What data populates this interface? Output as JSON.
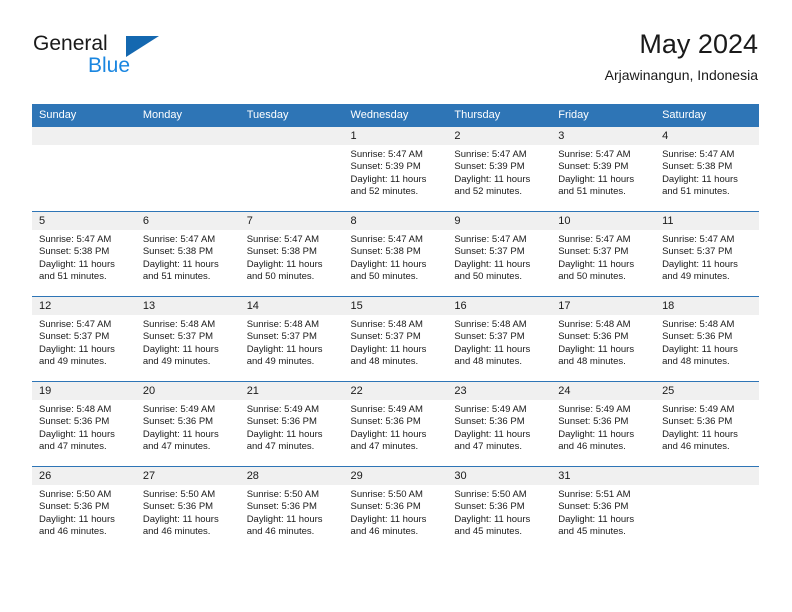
{
  "brand": {
    "name_part1": "General",
    "name_part2": "Blue",
    "triangle_color": "#1468b0",
    "blue_text_color": "#1a86e0"
  },
  "header": {
    "title": "May 2024",
    "subtitle": "Arjawinangun, Indonesia",
    "header_bg": "#2e75b6",
    "daynum_bg": "#f0f0f0"
  },
  "weekday_headers": [
    "Sunday",
    "Monday",
    "Tuesday",
    "Wednesday",
    "Thursday",
    "Friday",
    "Saturday"
  ],
  "weeks": [
    [
      {
        "day": "",
        "blank": true
      },
      {
        "day": "",
        "blank": true
      },
      {
        "day": "",
        "blank": true
      },
      {
        "day": "1",
        "sunrise": "Sunrise: 5:47 AM",
        "sunset": "Sunset: 5:39 PM",
        "daylight": "Daylight: 11 hours and 52 minutes."
      },
      {
        "day": "2",
        "sunrise": "Sunrise: 5:47 AM",
        "sunset": "Sunset: 5:39 PM",
        "daylight": "Daylight: 11 hours and 52 minutes."
      },
      {
        "day": "3",
        "sunrise": "Sunrise: 5:47 AM",
        "sunset": "Sunset: 5:39 PM",
        "daylight": "Daylight: 11 hours and 51 minutes."
      },
      {
        "day": "4",
        "sunrise": "Sunrise: 5:47 AM",
        "sunset": "Sunset: 5:38 PM",
        "daylight": "Daylight: 11 hours and 51 minutes."
      }
    ],
    [
      {
        "day": "5",
        "sunrise": "Sunrise: 5:47 AM",
        "sunset": "Sunset: 5:38 PM",
        "daylight": "Daylight: 11 hours and 51 minutes."
      },
      {
        "day": "6",
        "sunrise": "Sunrise: 5:47 AM",
        "sunset": "Sunset: 5:38 PM",
        "daylight": "Daylight: 11 hours and 51 minutes."
      },
      {
        "day": "7",
        "sunrise": "Sunrise: 5:47 AM",
        "sunset": "Sunset: 5:38 PM",
        "daylight": "Daylight: 11 hours and 50 minutes."
      },
      {
        "day": "8",
        "sunrise": "Sunrise: 5:47 AM",
        "sunset": "Sunset: 5:38 PM",
        "daylight": "Daylight: 11 hours and 50 minutes."
      },
      {
        "day": "9",
        "sunrise": "Sunrise: 5:47 AM",
        "sunset": "Sunset: 5:37 PM",
        "daylight": "Daylight: 11 hours and 50 minutes."
      },
      {
        "day": "10",
        "sunrise": "Sunrise: 5:47 AM",
        "sunset": "Sunset: 5:37 PM",
        "daylight": "Daylight: 11 hours and 50 minutes."
      },
      {
        "day": "11",
        "sunrise": "Sunrise: 5:47 AM",
        "sunset": "Sunset: 5:37 PM",
        "daylight": "Daylight: 11 hours and 49 minutes."
      }
    ],
    [
      {
        "day": "12",
        "sunrise": "Sunrise: 5:47 AM",
        "sunset": "Sunset: 5:37 PM",
        "daylight": "Daylight: 11 hours and 49 minutes."
      },
      {
        "day": "13",
        "sunrise": "Sunrise: 5:48 AM",
        "sunset": "Sunset: 5:37 PM",
        "daylight": "Daylight: 11 hours and 49 minutes."
      },
      {
        "day": "14",
        "sunrise": "Sunrise: 5:48 AM",
        "sunset": "Sunset: 5:37 PM",
        "daylight": "Daylight: 11 hours and 49 minutes."
      },
      {
        "day": "15",
        "sunrise": "Sunrise: 5:48 AM",
        "sunset": "Sunset: 5:37 PM",
        "daylight": "Daylight: 11 hours and 48 minutes."
      },
      {
        "day": "16",
        "sunrise": "Sunrise: 5:48 AM",
        "sunset": "Sunset: 5:37 PM",
        "daylight": "Daylight: 11 hours and 48 minutes."
      },
      {
        "day": "17",
        "sunrise": "Sunrise: 5:48 AM",
        "sunset": "Sunset: 5:36 PM",
        "daylight": "Daylight: 11 hours and 48 minutes."
      },
      {
        "day": "18",
        "sunrise": "Sunrise: 5:48 AM",
        "sunset": "Sunset: 5:36 PM",
        "daylight": "Daylight: 11 hours and 48 minutes."
      }
    ],
    [
      {
        "day": "19",
        "sunrise": "Sunrise: 5:48 AM",
        "sunset": "Sunset: 5:36 PM",
        "daylight": "Daylight: 11 hours and 47 minutes."
      },
      {
        "day": "20",
        "sunrise": "Sunrise: 5:49 AM",
        "sunset": "Sunset: 5:36 PM",
        "daylight": "Daylight: 11 hours and 47 minutes."
      },
      {
        "day": "21",
        "sunrise": "Sunrise: 5:49 AM",
        "sunset": "Sunset: 5:36 PM",
        "daylight": "Daylight: 11 hours and 47 minutes."
      },
      {
        "day": "22",
        "sunrise": "Sunrise: 5:49 AM",
        "sunset": "Sunset: 5:36 PM",
        "daylight": "Daylight: 11 hours and 47 minutes."
      },
      {
        "day": "23",
        "sunrise": "Sunrise: 5:49 AM",
        "sunset": "Sunset: 5:36 PM",
        "daylight": "Daylight: 11 hours and 47 minutes."
      },
      {
        "day": "24",
        "sunrise": "Sunrise: 5:49 AM",
        "sunset": "Sunset: 5:36 PM",
        "daylight": "Daylight: 11 hours and 46 minutes."
      },
      {
        "day": "25",
        "sunrise": "Sunrise: 5:49 AM",
        "sunset": "Sunset: 5:36 PM",
        "daylight": "Daylight: 11 hours and 46 minutes."
      }
    ],
    [
      {
        "day": "26",
        "sunrise": "Sunrise: 5:50 AM",
        "sunset": "Sunset: 5:36 PM",
        "daylight": "Daylight: 11 hours and 46 minutes."
      },
      {
        "day": "27",
        "sunrise": "Sunrise: 5:50 AM",
        "sunset": "Sunset: 5:36 PM",
        "daylight": "Daylight: 11 hours and 46 minutes."
      },
      {
        "day": "28",
        "sunrise": "Sunrise: 5:50 AM",
        "sunset": "Sunset: 5:36 PM",
        "daylight": "Daylight: 11 hours and 46 minutes."
      },
      {
        "day": "29",
        "sunrise": "Sunrise: 5:50 AM",
        "sunset": "Sunset: 5:36 PM",
        "daylight": "Daylight: 11 hours and 46 minutes."
      },
      {
        "day": "30",
        "sunrise": "Sunrise: 5:50 AM",
        "sunset": "Sunset: 5:36 PM",
        "daylight": "Daylight: 11 hours and 45 minutes."
      },
      {
        "day": "31",
        "sunrise": "Sunrise: 5:51 AM",
        "sunset": "Sunset: 5:36 PM",
        "daylight": "Daylight: 11 hours and 45 minutes."
      },
      {
        "day": "",
        "blank": true
      }
    ]
  ]
}
